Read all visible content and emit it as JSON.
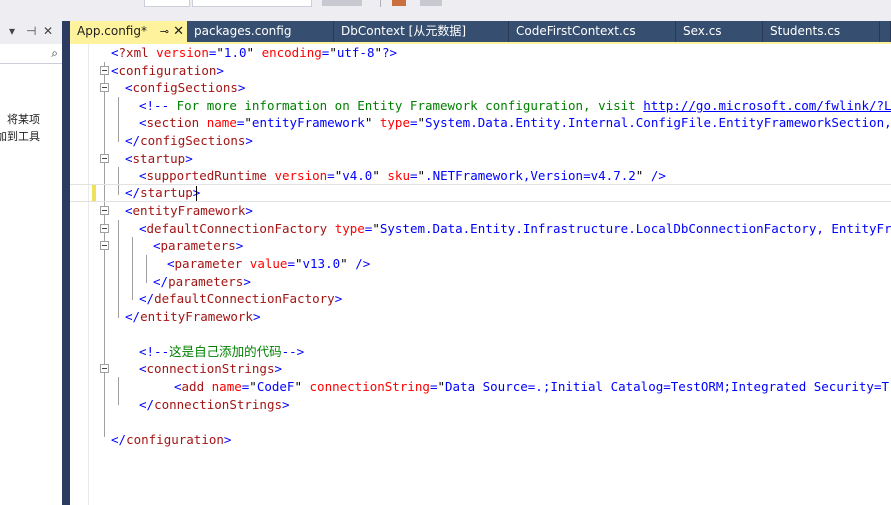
{
  "tool_panel": {
    "pin_glyph": "⊣",
    "close_glyph": "✕",
    "dropdown_glyph": "▾",
    "search_glyph": "⌕",
    "help_lines": [
      "。将某项",
      "加到工具"
    ]
  },
  "tabs": [
    {
      "label": "App.config*",
      "active": true
    },
    {
      "label": "packages.config",
      "active": false
    },
    {
      "label": "DbContext [从元数据]",
      "active": false
    },
    {
      "label": "CodeFirstContext.cs",
      "active": false
    },
    {
      "label": "Sex.cs",
      "active": false
    },
    {
      "label": "Students.cs",
      "active": false
    }
  ],
  "tab_pin_glyph": "⊸",
  "tab_close_glyph": "✕",
  "colors": {
    "active_tab": "#fff29d",
    "inactive_tab": "#364e6f",
    "tag": "#a31515",
    "attribute": "#ff0000",
    "value": "#0000ff",
    "comment": "#008000"
  },
  "code": {
    "l1_decl": "?xml",
    "l1_a1": "version",
    "l1_v1": "1.0",
    "l1_a2": "encoding",
    "l1_v2": "utf-8",
    "configuration": "configuration",
    "configSections": "configSections",
    "comment_text": " For more information on Entity Framework configuration, visit ",
    "comment_link": "http://go.microsoft.com/fwlink/?LinkID",
    "section": "section",
    "name_attr": "name",
    "section_name": "entityFramework",
    "type_attr": "type",
    "section_type": "System.Data.Entity.Internal.ConfigFile.EntityFrameworkSection, Enti",
    "startup": "startup",
    "supportedRuntime": "supportedRuntime",
    "version_attr": "version",
    "runtime_version": "v4.0",
    "sku_attr": "sku",
    "runtime_sku": ".NETFramework,Version=v4.7.2",
    "entityFramework": "entityFramework",
    "defaultConnectionFactory": "defaultConnectionFactory",
    "factory_type": "System.Data.Entity.Infrastructure.LocalDbConnectionFactory, EntityFramewo",
    "parameters": "parameters",
    "parameter": "parameter",
    "value_attr": "value",
    "parameter_value": "v13.0",
    "custom_comment": "这是自己添加的代码",
    "connectionStrings": "connectionStrings",
    "add": "add",
    "add_name": "CodeF",
    "cs_attr": "connectionString",
    "cs_value": "Data Source=.;Initial Catalog=TestORM;Integrated Security=True;"
  }
}
